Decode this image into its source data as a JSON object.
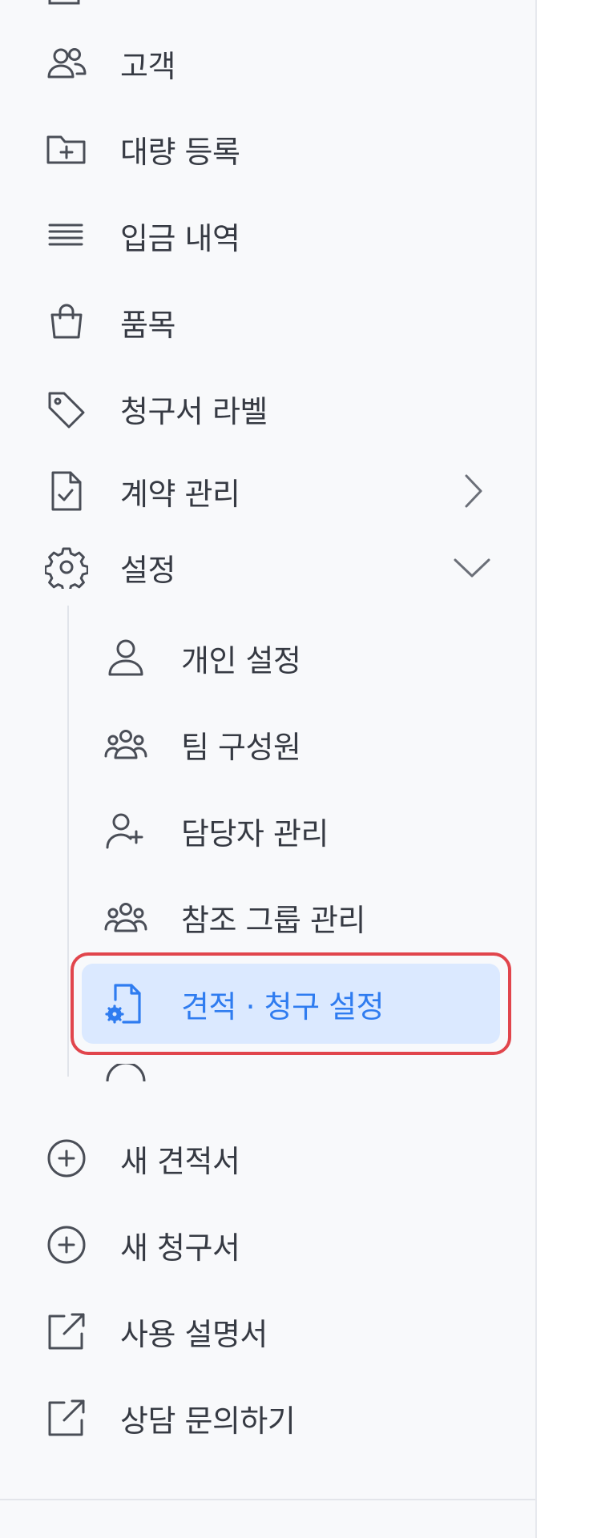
{
  "menu": {
    "customers": "고객",
    "bulk_register": "대량 등록",
    "deposit_history": "입금 내역",
    "items": "품목",
    "invoice_labels": "청구서 라벨",
    "contract_management": "계약 관리",
    "settings": "설정",
    "settings_sub": {
      "personal_settings": "개인 설정",
      "team_members": "팀 구성원",
      "manager_management": "담당자 관리",
      "reference_group_management": "참조 그룹 관리",
      "quote_invoice_settings": "견적 · 청구 설정"
    },
    "new_quote": "새 견적서",
    "new_invoice": "새 청구서",
    "user_manual": "사용 설명서",
    "contact_inquiry": "상담 문의하기"
  },
  "colors": {
    "text": "#363a43",
    "icon": "#4a4e57",
    "active_text": "#2f7cf0",
    "active_bg": "#dbe9ff",
    "highlight_border": "#e1454c",
    "sidebar_bg": "#f8f9fb"
  }
}
